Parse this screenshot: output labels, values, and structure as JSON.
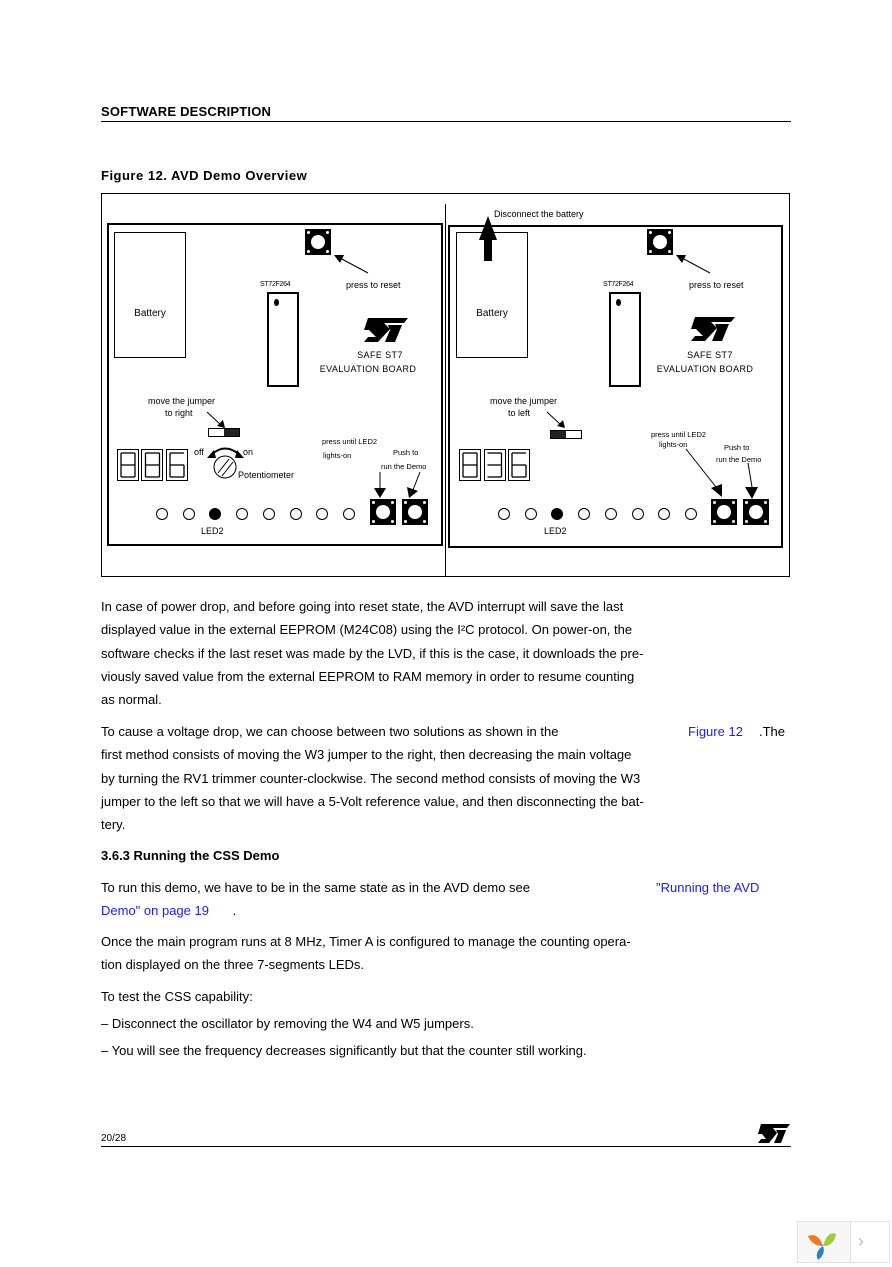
{
  "header": {
    "section": "SOFTWARE DESCRIPTION"
  },
  "figure": {
    "title": "Figure 12. AVD Demo Overview",
    "left_panel": {
      "battery_label": "Battery",
      "chip_label": "ST72F264",
      "reset_label": "press to reset",
      "board_name_line1": "SAFE ST7",
      "board_name_line2": "EVALUATION BOARD",
      "jumper_label_line1": "move the jumper",
      "jumper_label_line2": "to right",
      "jumper_position": "right",
      "pot_off": "off",
      "pot_on": "on",
      "pot_label": "Potentiometer",
      "press_label_line1": "press until LED2",
      "press_label_line2": "lights-on",
      "push_label_line1": "Push to",
      "push_label_line2": "run the Demo",
      "display_digits": [
        "8",
        "8",
        "6"
      ],
      "led_label": "LED2",
      "leds_on": [
        false,
        false,
        true,
        false,
        false,
        false,
        false,
        false
      ]
    },
    "right_panel": {
      "disconnect_label": "Disconnect the battery",
      "battery_label": "Battery",
      "chip_label": "ST72F264",
      "reset_label": "press to reset",
      "board_name_line1": "SAFE ST7",
      "board_name_line2": "EVALUATION BOARD",
      "jumper_label_line1": "move the jumper",
      "jumper_label_line2": "to left",
      "jumper_position": "left",
      "press_label_line1": "press until LED2",
      "press_label_line2": "lights-on",
      "push_label_line1": "Push to",
      "push_label_line2": "run the Demo",
      "display_digits": [
        "8",
        "3",
        "6"
      ],
      "led_label": "LED2",
      "leds_on": [
        false,
        false,
        true,
        false,
        false,
        false,
        false,
        false
      ]
    }
  },
  "body": {
    "p1": [
      "In case of power drop, and before going into reset state, the AVD interrupt will save the last",
      "displayed value in the external EEPROM (M24C08) using the I²C protocol. On power-on, the",
      "software checks if the last reset was made by the LVD, if this is the case, it downloads the pre-",
      "viously saved value from the external EEPROM to RAM memory in order to resume counting",
      "as normal."
    ],
    "p2_line1_before": "To cause a voltage drop, we can choose between two solutions as shown in the",
    "p2_link": "Figure 12",
    "p2_line1_after": ".The",
    "p2_rest": [
      "first method consists of moving the W3 jumper to the right, then decreasing the main voltage",
      "by turning the RV1 trimmer counter-clockwise. The second method consists of moving the W3",
      "jumper to the left so that we will have a 5-Volt reference value, and then disconnecting the bat-",
      "tery."
    ],
    "subheading": "3.6.3 Running the CSS Demo",
    "p3_before": "To run this demo, we have to be in the same state as in the AVD demo see",
    "p3_link_part1": "\"Running the AVD",
    "p3_link_part2": "Demo\" on page 19",
    "p3_after": ".",
    "p4": [
      "Once the main program runs at 8 MHz, Timer A is configured to manage the counting opera-",
      "tion displayed on the three 7-segments LEDs."
    ],
    "p5": "To test the CSS capability:",
    "bullets": [
      "– Disconnect the oscillator by removing the W4 and W5 jumpers.",
      "– You will see the frequency decreases significantly but that the counter still working."
    ]
  },
  "footer": {
    "page": "20/28",
    "logo": "st-logo-icon"
  },
  "widget": {
    "logo": "yii-logo-icon",
    "next": "›"
  }
}
